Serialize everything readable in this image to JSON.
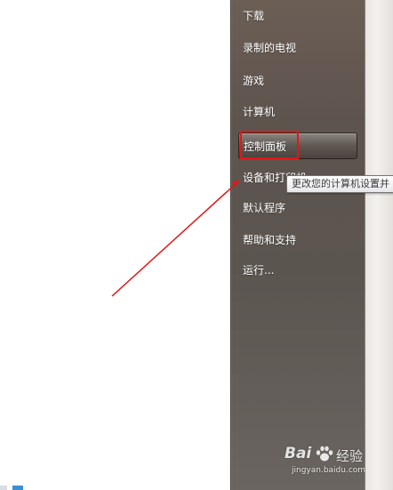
{
  "start_menu": {
    "items": [
      {
        "label": "下载"
      },
      {
        "label": "录制的电视"
      },
      {
        "label": "游戏"
      },
      {
        "label": "计算机"
      },
      {
        "label": "控制面板",
        "highlighted": true
      },
      {
        "label": "设备和打印机"
      },
      {
        "label": "默认程序"
      },
      {
        "label": "帮助和支持"
      },
      {
        "label": "运行..."
      }
    ]
  },
  "tooltip": {
    "text": "更改您的计算机设置并"
  },
  "annotation": {
    "color": "#e01818"
  },
  "watermark": {
    "logo": "Bai",
    "brand": "经验",
    "url": "jingyan.baidu.com"
  },
  "colors": {
    "panel": "#5e544e",
    "highlight": "#6f6862",
    "tooltip_bg": "#f2f2f5"
  }
}
